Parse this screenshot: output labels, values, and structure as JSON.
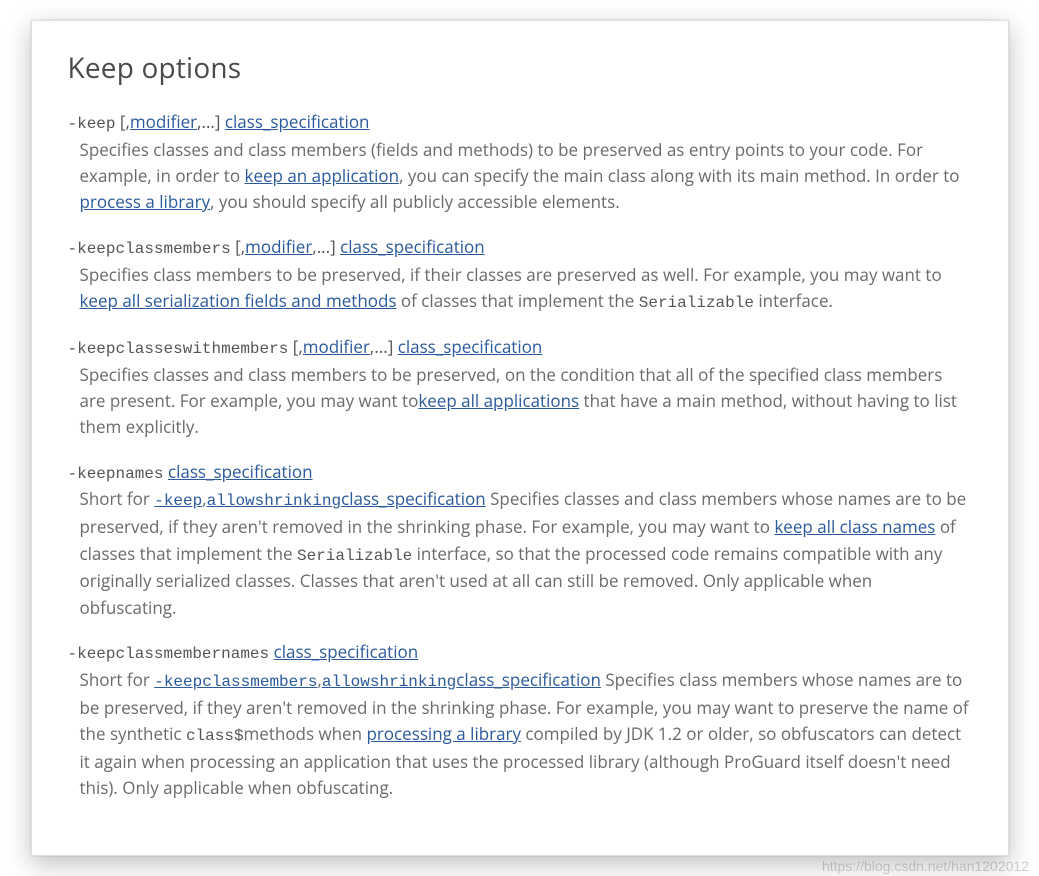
{
  "heading": "Keep options",
  "watermark": "https://blog.csdn.net/han1202012",
  "common": {
    "modifier": "modifier",
    "class_spec": "class_specification",
    "bracket_open": " [,",
    "bracket_close": ",...] "
  },
  "entries": [
    {
      "flag": "-keep",
      "has_modifier": true,
      "desc_parts": [
        {
          "t": "text",
          "v": "Specifies classes and class members (fields and methods) to be preserved as entry points to your code. For example, in order to "
        },
        {
          "t": "link",
          "v": "keep an application"
        },
        {
          "t": "text",
          "v": ", you can specify the main class along with its main method. In order to "
        },
        {
          "t": "link",
          "v": "process a library"
        },
        {
          "t": "text",
          "v": ", you should specify all publicly accessible elements."
        }
      ]
    },
    {
      "flag": "-keepclassmembers",
      "has_modifier": true,
      "desc_parts": [
        {
          "t": "text",
          "v": "Specifies class members to be preserved, if their classes are preserved as well. For example, you may want to "
        },
        {
          "t": "link",
          "v": "keep all serialization fields and methods"
        },
        {
          "t": "text",
          "v": " of classes that implement the "
        },
        {
          "t": "mono",
          "v": "Serializable"
        },
        {
          "t": "text",
          "v": " interface."
        }
      ]
    },
    {
      "flag": "-keepclasseswithmembers",
      "has_modifier": true,
      "desc_parts": [
        {
          "t": "text",
          "v": "Specifies classes and class members to be preserved, on the condition that all of the specified class members are present. For example, you may want to"
        },
        {
          "t": "link",
          "v": "keep all applications"
        },
        {
          "t": "text",
          "v": " that have a main method, without having to list them explicitly."
        }
      ]
    },
    {
      "flag": "-keepnames",
      "has_modifier": false,
      "desc_parts": [
        {
          "t": "text",
          "v": "Short for "
        },
        {
          "t": "monolink",
          "v": "-keep"
        },
        {
          "t": "text",
          "v": ","
        },
        {
          "t": "monolink",
          "v": "allowshrinking"
        },
        {
          "t": "link",
          "v": "class_specification"
        },
        {
          "t": "text",
          "v": " Specifies classes and class members whose names are to be preserved, if they aren't removed in the shrinking phase. For example, you may want to "
        },
        {
          "t": "link",
          "v": "keep all class names"
        },
        {
          "t": "text",
          "v": " of classes that implement the "
        },
        {
          "t": "mono",
          "v": "Serializable"
        },
        {
          "t": "text",
          "v": " interface, so that the processed code remains compatible with any originally serialized classes. Classes that aren't used at all can still be removed. Only applicable when obfuscating."
        }
      ]
    },
    {
      "flag": "-keepclassmembernames",
      "has_modifier": false,
      "desc_parts": [
        {
          "t": "text",
          "v": "Short for "
        },
        {
          "t": "monolink",
          "v": "-keepclassmembers"
        },
        {
          "t": "text",
          "v": ","
        },
        {
          "t": "monolink",
          "v": "allowshrinking"
        },
        {
          "t": "link",
          "v": "class_specification"
        },
        {
          "t": "text",
          "v": " Specifies class members whose names are to be preserved, if they aren't removed in the shrinking phase. For example, you may want to preserve the name of the synthetic "
        },
        {
          "t": "mono",
          "v": "class$"
        },
        {
          "t": "text",
          "v": "methods when "
        },
        {
          "t": "link",
          "v": "processing a library"
        },
        {
          "t": "text",
          "v": " compiled by JDK 1.2 or older, so obfuscators can detect it again when processing an application that uses the processed library (although ProGuard itself doesn't need this). Only applicable when obfuscating."
        }
      ]
    }
  ]
}
